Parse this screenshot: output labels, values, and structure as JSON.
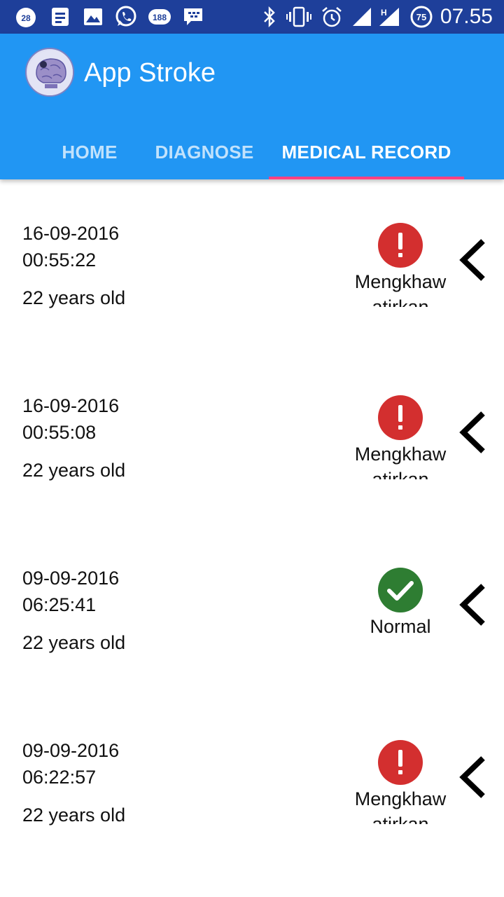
{
  "status_bar": {
    "time": "07.55",
    "notification_count_a": "28",
    "notification_count_b": "188",
    "battery_level": "75",
    "network_type": "H",
    "icons": [
      "notification-badge-icon",
      "document-icon",
      "image-icon",
      "whatsapp-icon",
      "badge-188-icon",
      "bbm-icon",
      "bluetooth-icon",
      "vibrate-icon",
      "alarm-icon",
      "signal-icon",
      "signal-h-icon",
      "battery-icon"
    ]
  },
  "app_bar": {
    "title": "App Stroke",
    "logo_icon": "brain-logo-icon",
    "color": "#2196f3"
  },
  "tabs": [
    {
      "label": "HOME",
      "active": false
    },
    {
      "label": "DIAGNOSE",
      "active": false
    },
    {
      "label": "MEDICAL RECORD",
      "active": true
    }
  ],
  "colors": {
    "accent": "#ff4081",
    "warning": "#d32f2f",
    "normal": "#2e7d32",
    "status_bar": "#1e3f9a"
  },
  "records": [
    {
      "date": "16-09-2016",
      "time": "00:55:22",
      "age": "22 years old",
      "status": "Mengkhawatirkan",
      "status_type": "warning",
      "status_icon": "exclamation-icon"
    },
    {
      "date": "16-09-2016",
      "time": "00:55:08",
      "age": "22 years old",
      "status": "Mengkhawatirkan",
      "status_type": "warning",
      "status_icon": "exclamation-icon"
    },
    {
      "date": "09-09-2016",
      "time": "06:25:41",
      "age": "22 years old",
      "status": "Normal",
      "status_type": "normal",
      "status_icon": "checkmark-icon"
    },
    {
      "date": "09-09-2016",
      "time": "06:22:57",
      "age": "22 years old",
      "status": "Mengkhawatirkan",
      "status_type": "warning",
      "status_icon": "exclamation-icon"
    }
  ]
}
